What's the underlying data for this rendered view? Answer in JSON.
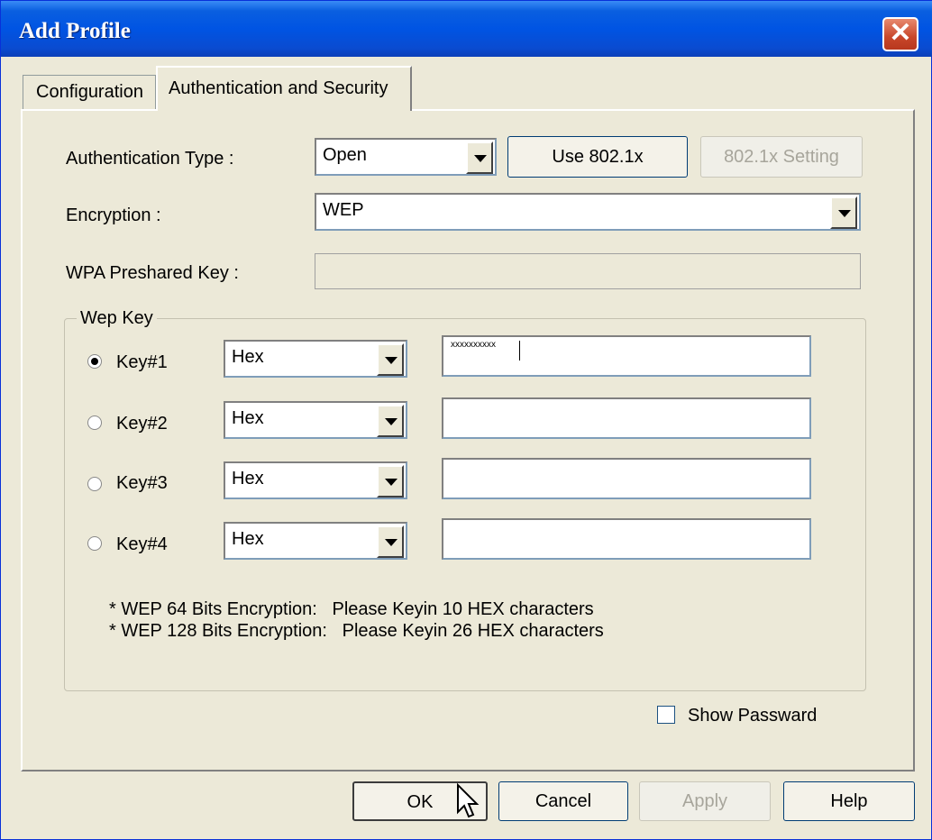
{
  "window": {
    "title": "Add Profile",
    "close_symbol": "✕"
  },
  "tabs": [
    {
      "label": "Configuration",
      "active": false
    },
    {
      "label": "Authentication and Security",
      "active": true
    }
  ],
  "auth": {
    "label": "Authentication Type :",
    "value": "Open",
    "use8021x_label": "Use 802.1x",
    "setting_label": "802.1x Setting"
  },
  "encryption": {
    "label": "Encryption :",
    "value": "WEP"
  },
  "wpa": {
    "label": "WPA Preshared Key :",
    "value": ""
  },
  "wepkey": {
    "group_label": "Wep Key",
    "keys": [
      {
        "label": "Key#1",
        "format": "Hex",
        "value": "xxxxxxxxxx",
        "selected": true
      },
      {
        "label": "Key#2",
        "format": "Hex",
        "value": "",
        "selected": false
      },
      {
        "label": "Key#3",
        "format": "Hex",
        "value": "",
        "selected": false
      },
      {
        "label": "Key#4",
        "format": "Hex",
        "value": "",
        "selected": false
      }
    ],
    "note1": "* WEP 64 Bits Encryption:   Please Keyin 10 HEX characters",
    "note2": "* WEP 128 Bits Encryption:   Please Keyin 26 HEX characters"
  },
  "show_password": {
    "label": "Show Passward",
    "checked": false
  },
  "buttons": {
    "ok": "OK",
    "cancel": "Cancel",
    "apply": "Apply",
    "help": "Help"
  }
}
